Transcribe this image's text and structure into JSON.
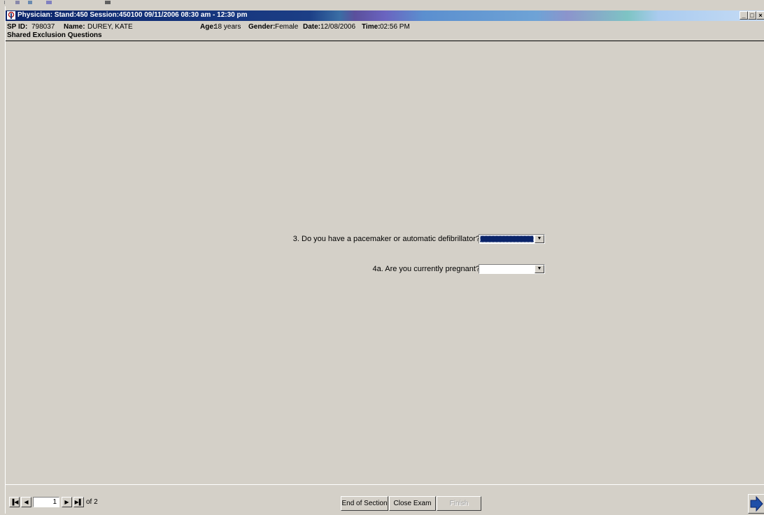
{
  "window": {
    "title": "Physician: Stand:450 Session:450100 09/11/2006 08:30 am - 12:30 pm",
    "controls": [
      "_",
      "□",
      "×"
    ]
  },
  "info": {
    "sp_id_label": "SP ID:",
    "sp_id": "798037",
    "name_label": "Name:",
    "name": "DUREY, KATE",
    "age_label": "Age:",
    "age": "18 years",
    "gender_label": "Gender:",
    "gender": "Female",
    "date_label": "Date:",
    "date": "12/08/2006",
    "time_label": "Time:",
    "time": "02:56 PM"
  },
  "section": {
    "title": "Shared Exclusion Questions"
  },
  "questions": [
    {
      "label": "3. Do you have a pacemaker or automatic defibrillator?",
      "value": ""
    },
    {
      "label": "4a. Are you currently pregnant?",
      "value": ""
    }
  ],
  "nav": {
    "page": "1",
    "of_text": "of 2"
  },
  "buttons": {
    "end_of_section": "End of Section",
    "close_exam": "Close Exam",
    "finish": "Finish"
  },
  "icons": {
    "app": "caduceus-icon",
    "first": "first-page-icon",
    "prev": "prev-page-icon",
    "next": "next-page-icon",
    "last": "last-page-icon",
    "proceed": "proceed-arrow-icon"
  },
  "colors": {
    "title_bar": "#0a246a",
    "selection": "#0a246a",
    "window_bg": "#d4d0c8"
  }
}
